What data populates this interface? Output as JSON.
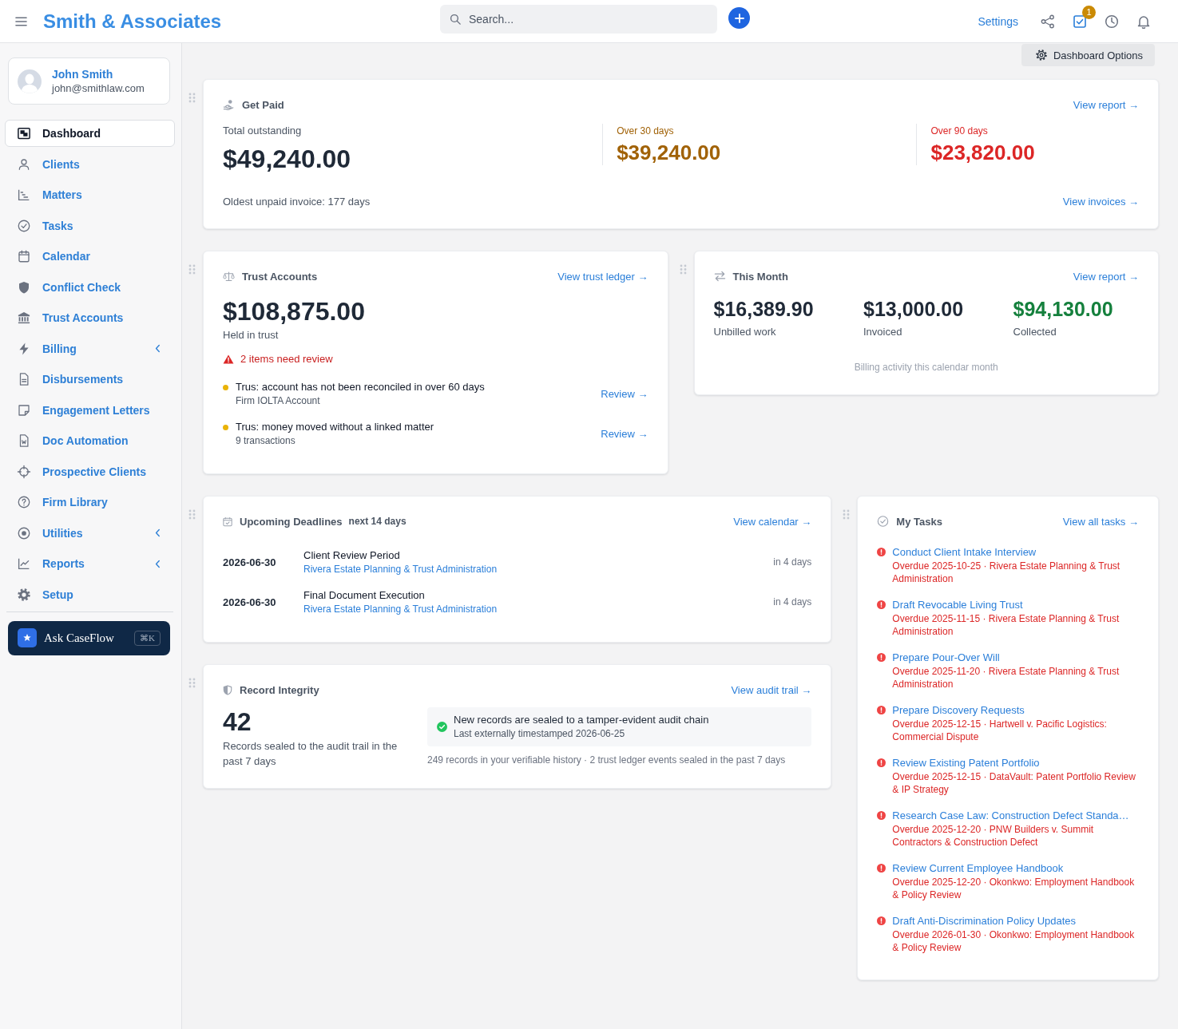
{
  "top_bar": {
    "brand": "Smith & Associates",
    "search": {
      "placeholder": "Search..."
    },
    "settings_link": "Settings",
    "tasks_badge": "1"
  },
  "sidebar": {
    "user": {
      "name": "John Smith",
      "email": "john@smithlaw.com"
    },
    "nav": [
      {
        "label": "Dashboard",
        "selected": true,
        "has_submenu": false
      },
      {
        "label": "Clients",
        "selected": false,
        "has_submenu": false
      },
      {
        "label": "Matters",
        "selected": false,
        "has_submenu": false
      },
      {
        "label": "Tasks",
        "selected": false,
        "has_submenu": false
      },
      {
        "label": "Calendar",
        "selected": false,
        "has_submenu": false
      },
      {
        "label": "Conflict Check",
        "selected": false,
        "has_submenu": false
      },
      {
        "label": "Trust Accounts",
        "selected": false,
        "has_submenu": false
      },
      {
        "label": "Billing",
        "selected": false,
        "has_submenu": true
      },
      {
        "label": "Disbursements",
        "selected": false,
        "has_submenu": false
      },
      {
        "label": "Engagement Letters",
        "selected": false,
        "has_submenu": false
      },
      {
        "label": "Doc Automation",
        "selected": false,
        "has_submenu": false
      },
      {
        "label": "Prospective Clients",
        "selected": false,
        "has_submenu": false
      },
      {
        "label": "Firm Library",
        "selected": false,
        "has_submenu": false
      },
      {
        "label": "Utilities",
        "selected": false,
        "has_submenu": true
      },
      {
        "label": "Reports",
        "selected": false,
        "has_submenu": true
      },
      {
        "label": "Setup",
        "selected": false,
        "has_submenu": false
      }
    ],
    "assistant": {
      "label": "Ask CaseFlow",
      "shortcut": "⌘K"
    }
  },
  "toolbar": {
    "options_button": "Dashboard Options"
  },
  "get_paid": {
    "title": "Get Paid",
    "report_link": "View report →",
    "total": {
      "label": "Total outstanding",
      "amount": "$49,240.00"
    },
    "buckets": [
      {
        "label": "Over 30 days",
        "amount": "$39,240.00",
        "color": "#a16207"
      },
      {
        "label": "Over 90 days",
        "amount": "$23,820.00",
        "color": "#dc2626"
      }
    ],
    "oldest": "Oldest unpaid invoice: 177 days",
    "invoices_link": "View invoices →"
  },
  "trust_accounts": {
    "title": "Trust Accounts",
    "link": "View trust ledger →",
    "amount": "$108,875.00",
    "caption": "Held in trust",
    "alert": "2 items need review",
    "items": [
      {
        "title": "Trus: account has not been reconciled in over 60 days",
        "detail": "Firm IOLTA Account",
        "action": "Review →"
      },
      {
        "title": "Trus: money moved without a linked matter",
        "detail": "9 transactions",
        "action": "Review →"
      }
    ]
  },
  "this_month": {
    "title": "This Month",
    "link": "View report →",
    "stats": [
      {
        "amount": "$16,389.90",
        "label": "Unbilled work",
        "color": "#1f2937"
      },
      {
        "amount": "$13,000.00",
        "label": "Invoiced",
        "color": "#1f2937"
      },
      {
        "amount": "$94,130.00",
        "label": "Collected",
        "color": "#15803d"
      }
    ],
    "footnote": "Billing activity this calendar month"
  },
  "deadlines": {
    "title": "Upcoming Deadlines",
    "range": "next 14 days",
    "link": "View calendar →",
    "rows": [
      {
        "date": "2026-06-30",
        "title": "Client Review Period",
        "matter": "Rivera Estate Planning & Trust Administration",
        "due": "in 4 days"
      },
      {
        "date": "2026-06-30",
        "title": "Final Document Execution",
        "matter": "Rivera Estate Planning & Trust Administration",
        "due": "in 4 days"
      }
    ]
  },
  "record_integrity": {
    "title": "Record Integrity",
    "link": "View audit trail →",
    "count": "42",
    "count_caption": "Records sealed to the audit trail in the past 7 days",
    "notice": {
      "title": "New records are sealed to a tamper-evident audit chain",
      "detail": "Last externally timestamped 2026-06-25"
    },
    "footnote": "249 records in your verifiable history · 2 trust ledger events sealed in the past 7 days"
  },
  "my_tasks": {
    "title": "My Tasks",
    "link": "View all tasks →",
    "tasks": [
      {
        "title": "Conduct Client Intake Interview",
        "detail": "Overdue 2025-10-25 · Rivera Estate Planning & Trust Administration",
        "overdue": true
      },
      {
        "title": "Draft Revocable Living Trust",
        "detail": "Overdue 2025-11-15 · Rivera Estate Planning & Trust Administration",
        "overdue": true
      },
      {
        "title": "Prepare Pour-Over Will",
        "detail": "Overdue 2025-11-20 · Rivera Estate Planning & Trust Administration",
        "overdue": true
      },
      {
        "title": "Prepare Discovery Requests",
        "detail": "Overdue 2025-12-15 · Hartwell v. Pacific Logistics: Commercial Dispute",
        "overdue": true
      },
      {
        "title": "Review Existing Patent Portfolio",
        "detail": "Overdue 2025-12-15 · DataVault: Patent Portfolio Review & IP Strategy",
        "overdue": true
      },
      {
        "title": "Research Case Law: Construction Defect Standa…",
        "detail": "Overdue 2025-12-20 · PNW Builders v. Summit Contractors & Construction Defect",
        "overdue": true
      },
      {
        "title": "Review Current Employee Handbook",
        "detail": "Overdue 2025-12-20 · Okonkwo: Employment Handbook & Policy Review",
        "overdue": true
      },
      {
        "title": "Draft Anti-Discrimination Policy Updates",
        "detail": "Overdue 2026-01-30 · Okonkwo: Employment Handbook & Policy Review",
        "overdue": true
      }
    ]
  }
}
